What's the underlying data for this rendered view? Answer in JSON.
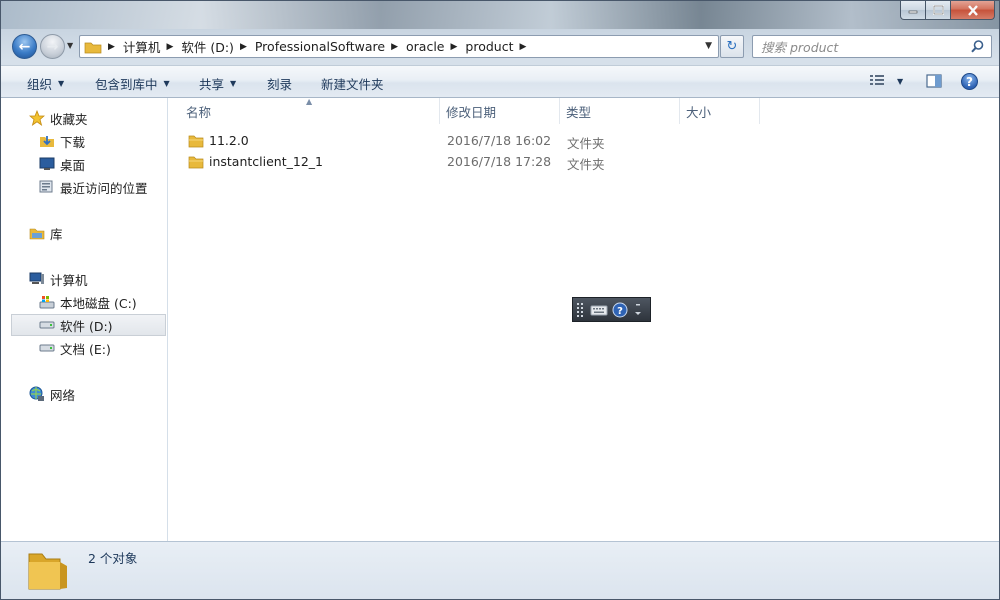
{
  "address": {
    "breadcrumbs": [
      "计算机",
      "软件 (D:)",
      "ProfessionalSoftware",
      "oracle",
      "product"
    ],
    "search_placeholder": "搜索 product"
  },
  "toolbar": {
    "organize": "组织",
    "include_in_library": "包含到库中",
    "share": "共享",
    "burn": "刻录",
    "new_folder": "新建文件夹"
  },
  "nav": {
    "favorites": "收藏夹",
    "downloads": "下载",
    "desktop": "桌面",
    "recent": "最近访问的位置",
    "libraries": "库",
    "computer": "计算机",
    "drive_c": "本地磁盘 (C:)",
    "drive_d": "软件 (D:)",
    "drive_e": "文档 (E:)",
    "network": "网络"
  },
  "columns": {
    "name": "名称",
    "modified": "修改日期",
    "type": "类型",
    "size": "大小"
  },
  "files": [
    {
      "name": "11.2.0",
      "modified": "2016/7/18 16:02",
      "type": "文件夹"
    },
    {
      "name": "instantclient_12_1",
      "modified": "2016/7/18 17:28",
      "type": "文件夹"
    }
  ],
  "status": {
    "count": "2 个对象"
  },
  "colors": {
    "accent": "#1e395b",
    "folder": "#e8b93c"
  }
}
